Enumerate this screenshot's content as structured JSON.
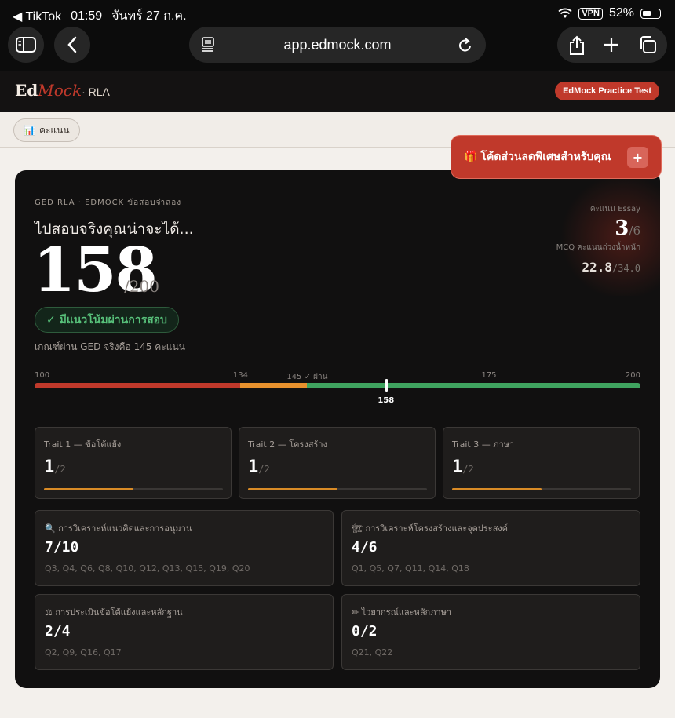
{
  "status_bar": {
    "back_app": "◀ TikTok",
    "time": "01:59",
    "date": "จันทร์ 27 ก.ค.",
    "vpn": "VPN",
    "battery": "52%"
  },
  "browser": {
    "url": "app.edmock.com"
  },
  "site": {
    "logo_ed": "Ed",
    "logo_mock": "Mock",
    "logo_suffix": "· RLA",
    "practice_button": "EdMock Practice Test"
  },
  "subnav": {
    "score_tab_icon": "📊",
    "score_tab": "คะแนน"
  },
  "promo": {
    "icon": "🎁",
    "label": "โค้ดส่วนลดพิเศษสำหรับคุณ",
    "plus": "+"
  },
  "result": {
    "eyebrow": "GED RLA · EDMOCK ข้อสอบจำลอง",
    "headline": "ไปสอบจริงคุณน่าจะได้...",
    "score": "158",
    "score_max": "/200",
    "pass_badge": "✓ มีแนวโน้มผ่านการสอบ",
    "threshold_note": "เกณฑ์ผ่าน GED จริงคือ 145 คะแนน",
    "essay_label": "คะแนน Essay",
    "essay_score": "3",
    "essay_max": "/6",
    "mcq_label": "MCQ คะแนนถ่วงน้ำหนัก",
    "mcq_score": "22.8",
    "mcq_max": "/34.0"
  },
  "scale": {
    "min": 100,
    "max": 200,
    "ticks": [
      {
        "value": 100,
        "label": "100"
      },
      {
        "value": 134,
        "label": "134"
      },
      {
        "value": 145,
        "label": "145 ✓ ผ่าน"
      },
      {
        "value": 175,
        "label": "175"
      },
      {
        "value": 200,
        "label": "200"
      }
    ],
    "segments": [
      {
        "from": 100,
        "to": 134,
        "color": "#c0392b"
      },
      {
        "from": 134,
        "to": 145,
        "color": "#e8912d"
      },
      {
        "from": 145,
        "to": 200,
        "color": "#3fa35f"
      }
    ],
    "marker_value": 158,
    "marker_label": "158"
  },
  "traits": [
    {
      "title": "Trait 1 — ข้อโต้แย้ง",
      "score": "1",
      "max": "/2",
      "fraction": 0.5
    },
    {
      "title": "Trait 2 — โครงสร้าง",
      "score": "1",
      "max": "/2",
      "fraction": 0.5
    },
    {
      "title": "Trait 3 — ภาษา",
      "score": "1",
      "max": "/2",
      "fraction": 0.5
    }
  ],
  "categories": [
    {
      "icon": "🔍",
      "title": "การวิเคราะห์แนวคิดและการอนุมาน",
      "score": "7/10",
      "questions": "Q3, Q4, Q6, Q8, Q10, Q12, Q13, Q15, Q19, Q20"
    },
    {
      "icon": "🏗",
      "title": "การวิเคราะห์โครงสร้างและจุดประสงค์",
      "score": "4/6",
      "questions": "Q1, Q5, Q7, Q11, Q14, Q18"
    },
    {
      "icon": "⚖",
      "title": "การประเมินข้อโต้แย้งและหลักฐาน",
      "score": "2/4",
      "questions": "Q2, Q9, Q16, Q17"
    },
    {
      "icon": "✏",
      "title": "ไวยากรณ์และหลักภาษา",
      "score": "0/2",
      "questions": "Q21, Q22"
    }
  ],
  "colors": {
    "accent": "#c0392b",
    "pass": "#58c27b",
    "trait_fill": "#d98b26"
  }
}
